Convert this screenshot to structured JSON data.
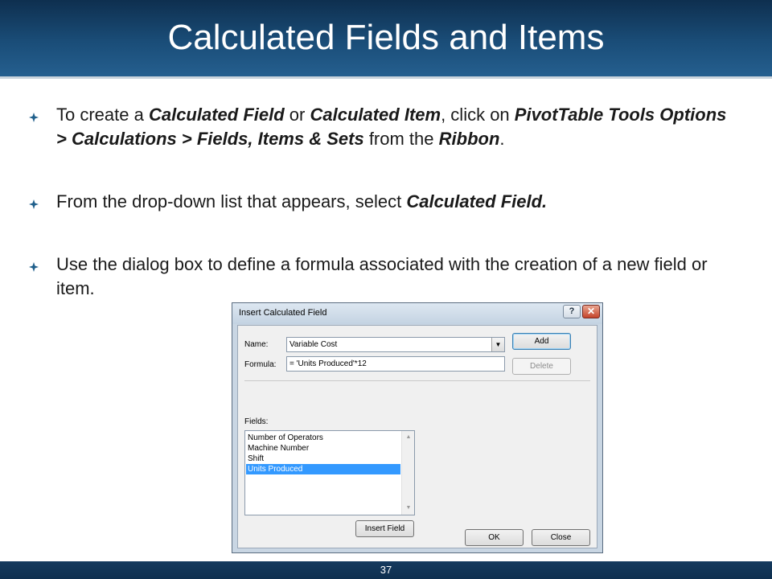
{
  "slide": {
    "title": "Calculated Fields and Items",
    "page_number": "37"
  },
  "bullets": [
    {
      "icon": "diamond-bullet-icon",
      "parts": [
        {
          "t": "To create a ",
          "b": false
        },
        {
          "t": "Calculated Field",
          "b": true
        },
        {
          "t": " or ",
          "b": false
        },
        {
          "t": "Calculated Item",
          "b": true
        },
        {
          "t": ", click on ",
          "b": false
        },
        {
          "t": "PivotTable Tools Options > Calculations > Fields, Items & Sets",
          "b": true
        },
        {
          "t": " from the ",
          "b": false
        },
        {
          "t": "Ribbon",
          "b": true
        },
        {
          "t": ".",
          "b": false
        }
      ]
    },
    {
      "icon": "diamond-bullet-icon",
      "parts": [
        {
          "t": "From the drop-down list that appears, select ",
          "b": false
        },
        {
          "t": "Calculated Field.",
          "b": true
        }
      ]
    },
    {
      "icon": "diamond-bullet-icon",
      "parts": [
        {
          "t": "Use the dialog box to define a formula associated with the creation of a new field or item.",
          "b": false
        }
      ]
    }
  ],
  "dialog": {
    "title": "Insert Calculated Field",
    "help_label": "?",
    "close_label": "✕",
    "name_label": "Name:",
    "name_value": "Variable Cost",
    "formula_label": "Formula:",
    "formula_value": "= 'Units Produced'*12",
    "add_label": "Add",
    "delete_label": "Delete",
    "fields_label": "Fields:",
    "fields": [
      "Number of Operators",
      "Machine Number",
      "Shift",
      "Units Produced"
    ],
    "selected_field": "Units Produced",
    "insert_field_label": "Insert Field",
    "ok_label": "OK",
    "close_button_label": "Close"
  },
  "colors": {
    "title_bar": "#1a4d78",
    "bullet_icon": "#1f5f8b",
    "selection": "#3399ff"
  }
}
